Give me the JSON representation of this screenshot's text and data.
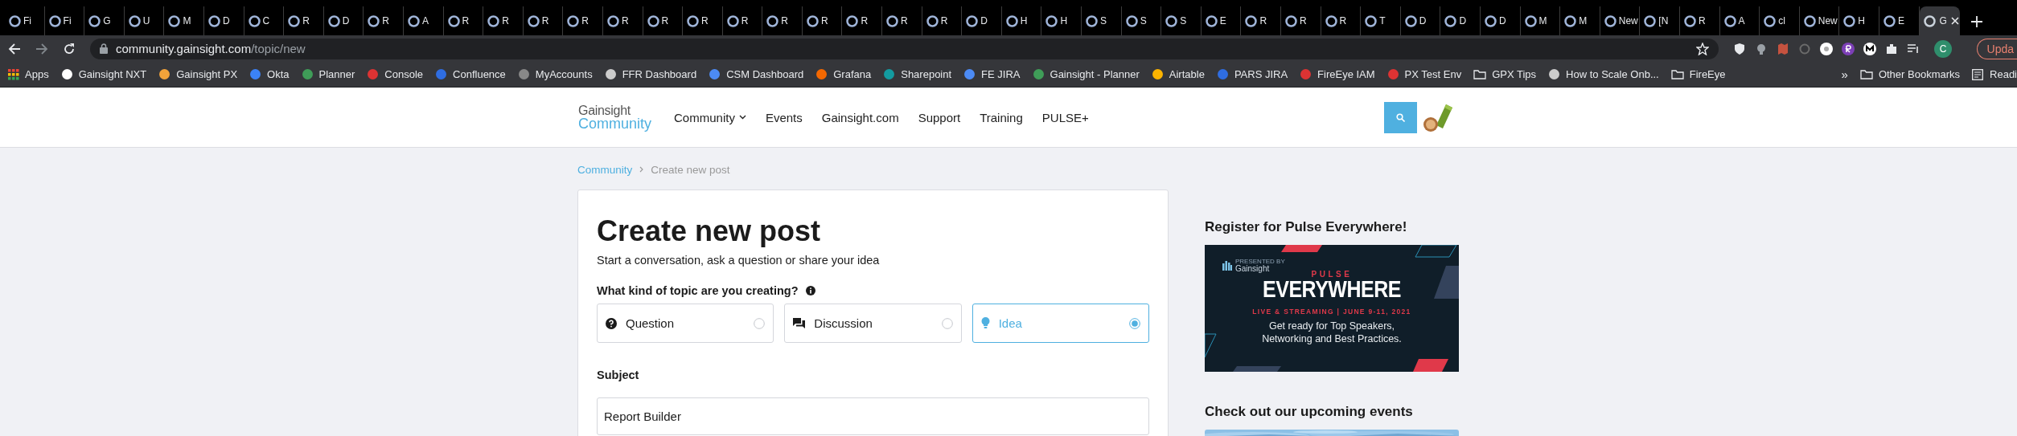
{
  "browser": {
    "tabs": [
      {
        "title": "Fi",
        "selected": false
      },
      {
        "title": "Fi",
        "selected": false
      },
      {
        "title": "G",
        "selected": false
      },
      {
        "title": "U",
        "selected": false
      },
      {
        "title": "M",
        "selected": false
      },
      {
        "title": "D",
        "selected": false
      },
      {
        "title": "C",
        "selected": false
      },
      {
        "title": "R",
        "selected": false
      },
      {
        "title": "D",
        "selected": false
      },
      {
        "title": "R",
        "selected": false
      },
      {
        "title": "A",
        "selected": false
      },
      {
        "title": "R",
        "selected": false
      },
      {
        "title": "R",
        "selected": false
      },
      {
        "title": "R",
        "selected": false
      },
      {
        "title": "R",
        "selected": false
      },
      {
        "title": "R",
        "selected": false
      },
      {
        "title": "R",
        "selected": false
      },
      {
        "title": "R",
        "selected": false
      },
      {
        "title": "R",
        "selected": false
      },
      {
        "title": "R",
        "selected": false
      },
      {
        "title": "R",
        "selected": false
      },
      {
        "title": "R",
        "selected": false
      },
      {
        "title": "R",
        "selected": false
      },
      {
        "title": "R",
        "selected": false
      },
      {
        "title": "D",
        "selected": false
      },
      {
        "title": "H",
        "selected": false
      },
      {
        "title": "H",
        "selected": false
      },
      {
        "title": "S",
        "selected": false
      },
      {
        "title": "S",
        "selected": false
      },
      {
        "title": "S",
        "selected": false
      },
      {
        "title": "E",
        "selected": false
      },
      {
        "title": "R",
        "selected": false
      },
      {
        "title": "R",
        "selected": false
      },
      {
        "title": "R",
        "selected": false
      },
      {
        "title": "T",
        "selected": false
      },
      {
        "title": "D",
        "selected": false
      },
      {
        "title": "D",
        "selected": false
      },
      {
        "title": "D",
        "selected": false
      },
      {
        "title": "M",
        "selected": false
      },
      {
        "title": "M",
        "selected": false
      },
      {
        "title": "New",
        "selected": false
      },
      {
        "title": "[N",
        "selected": false
      },
      {
        "title": "R",
        "selected": false
      },
      {
        "title": "A",
        "selected": false
      },
      {
        "title": "cl",
        "selected": false
      },
      {
        "title": "New",
        "selected": false
      },
      {
        "title": "H",
        "selected": false
      },
      {
        "title": "E",
        "selected": false
      },
      {
        "title": "G",
        "selected": true
      }
    ],
    "address": {
      "host": "community.gainsight.com",
      "path": "/topic/new"
    },
    "profile_initial": "C",
    "update_button": "Upda",
    "bookmarks": [
      {
        "label": "Apps",
        "kind": "apps"
      },
      {
        "label": "Gainsight NXT",
        "kind": "site"
      },
      {
        "label": "Gainsight PX",
        "kind": "site"
      },
      {
        "label": "Okta",
        "kind": "site"
      },
      {
        "label": "Planner",
        "kind": "site"
      },
      {
        "label": "Console",
        "kind": "site"
      },
      {
        "label": "Confluence",
        "kind": "site"
      },
      {
        "label": "MyAccounts",
        "kind": "site"
      },
      {
        "label": "FFR Dashboard",
        "kind": "site"
      },
      {
        "label": "CSM Dashboard",
        "kind": "site"
      },
      {
        "label": "Grafana",
        "kind": "site"
      },
      {
        "label": "Sharepoint",
        "kind": "site"
      },
      {
        "label": "FE JIRA",
        "kind": "site"
      },
      {
        "label": "Gainsight - Planner",
        "kind": "site"
      },
      {
        "label": "Airtable",
        "kind": "site"
      },
      {
        "label": "PARS JIRA",
        "kind": "site"
      },
      {
        "label": "FireEye IAM",
        "kind": "site"
      },
      {
        "label": "PX Test Env",
        "kind": "site"
      },
      {
        "label": "GPX Tips",
        "kind": "folder"
      },
      {
        "label": "How to Scale Onb...",
        "kind": "site"
      },
      {
        "label": "FireEye",
        "kind": "folder"
      }
    ],
    "overflow": "»",
    "other_bookmarks": "Other Bookmarks",
    "reading_list": "Readi"
  },
  "site": {
    "logo": {
      "line1": "Gainsight",
      "line2": "Community"
    },
    "nav": [
      {
        "label": "Community",
        "dropdown": true
      },
      {
        "label": "Events",
        "dropdown": false
      },
      {
        "label": "Gainsight.com",
        "dropdown": false
      },
      {
        "label": "Support",
        "dropdown": false
      },
      {
        "label": "Training",
        "dropdown": false
      },
      {
        "label": "PULSE+",
        "dropdown": false
      }
    ],
    "breadcrumb": [
      "Community",
      "Create new post"
    ]
  },
  "form": {
    "title": "Create new post",
    "subtitle": "Start a conversation, ask a question or share your idea",
    "topic_question": "What kind of topic are you creating?",
    "topic_types": [
      {
        "label": "Question",
        "kind": "question",
        "selected": false
      },
      {
        "label": "Discussion",
        "kind": "discussion",
        "selected": false
      },
      {
        "label": "Idea",
        "kind": "idea",
        "selected": true
      }
    ],
    "subject_label": "Subject",
    "subject_value": "Report Builder"
  },
  "sidebar": {
    "register_heading": "Register for Pulse Everywhere!",
    "banner": {
      "presented_by": "PRESENTED BY",
      "brand": "Gainsight",
      "eyebrow": "PULSE",
      "title": "EVERYWHERE",
      "dates": "LIVE & STREAMING | JUNE 9-11, 2021",
      "tagline": "Get ready for Top Speakers, Networking and Best Practices."
    },
    "events_heading": "Check out our upcoming events"
  }
}
